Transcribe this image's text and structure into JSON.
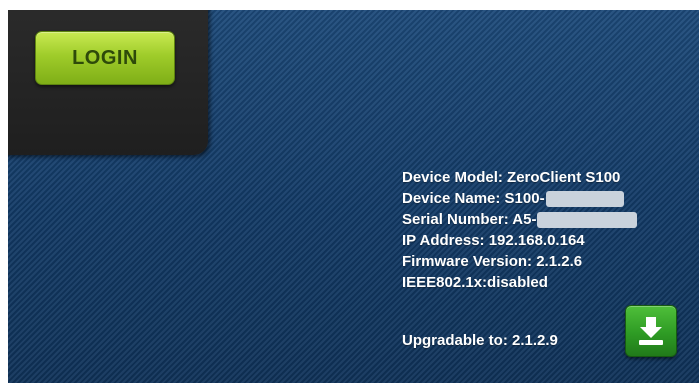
{
  "login": {
    "label": "LOGIN"
  },
  "device": {
    "model": "Device Model: ZeroClient S100",
    "name": "Device Name: S100-",
    "serial": "Serial Number: A5-",
    "ip": "IP Address: 192.168.0.164",
    "firmware": "Firmware Version: 2.1.2.6",
    "ieee": "IEEE802.1x:disabled"
  },
  "upgrade": {
    "label": "Upgradable to: 2.1.2.9",
    "icon": "download-icon"
  },
  "colors": {
    "background": "#123a66",
    "login_button": "#9fcc2a",
    "upgrade_button": "#2e9b24",
    "panel": "#1f1f1f",
    "text": "#ffffff"
  }
}
